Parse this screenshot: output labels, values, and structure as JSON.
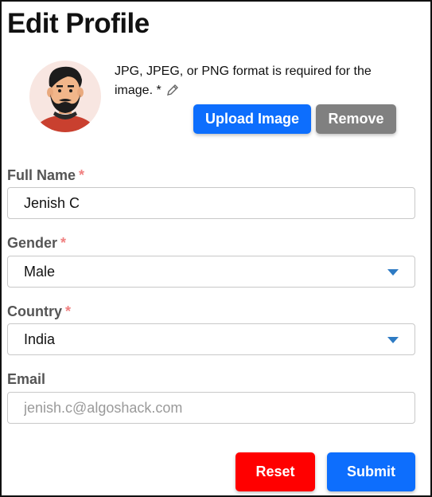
{
  "page": {
    "title": "Edit Profile"
  },
  "profile_image": {
    "note": "JPG, JPEG, or PNG format is required for the image. *",
    "upload_label": "Upload Image",
    "remove_label": "Remove"
  },
  "form": {
    "full_name": {
      "label": "Full Name",
      "required_mark": "*",
      "value": "Jenish C"
    },
    "gender": {
      "label": "Gender",
      "required_mark": "*",
      "selected": "Male"
    },
    "country": {
      "label": "Country",
      "required_mark": "*",
      "selected": "India"
    },
    "email": {
      "label": "Email",
      "placeholder": "jenish.c@algoshack.com"
    }
  },
  "actions": {
    "reset_label": "Reset",
    "submit_label": "Submit"
  },
  "colors": {
    "primary": "#0d6efd",
    "danger": "#ff0000",
    "secondary": "#808080",
    "required": "#f08080",
    "caret": "#2e7bc4"
  }
}
